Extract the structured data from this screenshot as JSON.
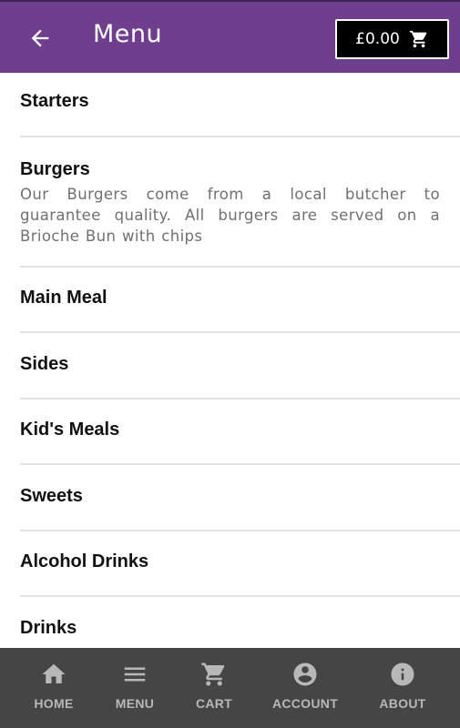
{
  "header": {
    "title": "Menu",
    "back_icon": "arrow-left-icon",
    "cart_total": "£0.00",
    "cart_icon": "cart-icon",
    "bg_color": "#6f3f8e"
  },
  "menu": {
    "categories": [
      {
        "title": "Starters",
        "description": ""
      },
      {
        "title": "Burgers",
        "description": "Our Burgers come from a local butcher to guarantee quality. All burgers are served on a Brioche Bun with chips"
      },
      {
        "title": "Main Meal",
        "description": ""
      },
      {
        "title": "Sides",
        "description": ""
      },
      {
        "title": "Kid's Meals",
        "description": ""
      },
      {
        "title": "Sweets",
        "description": ""
      },
      {
        "title": "Alcohol Drinks",
        "description": ""
      },
      {
        "title": "Drinks",
        "description": ""
      }
    ]
  },
  "bottom_nav": {
    "bg_color": "#454545",
    "items": [
      {
        "label": "HOME",
        "icon": "home-icon"
      },
      {
        "label": "MENU",
        "icon": "menu-icon"
      },
      {
        "label": "CART",
        "icon": "cart-icon"
      },
      {
        "label": "ACCOUNT",
        "icon": "account-icon"
      },
      {
        "label": "ABOUT",
        "icon": "info-icon"
      }
    ]
  }
}
